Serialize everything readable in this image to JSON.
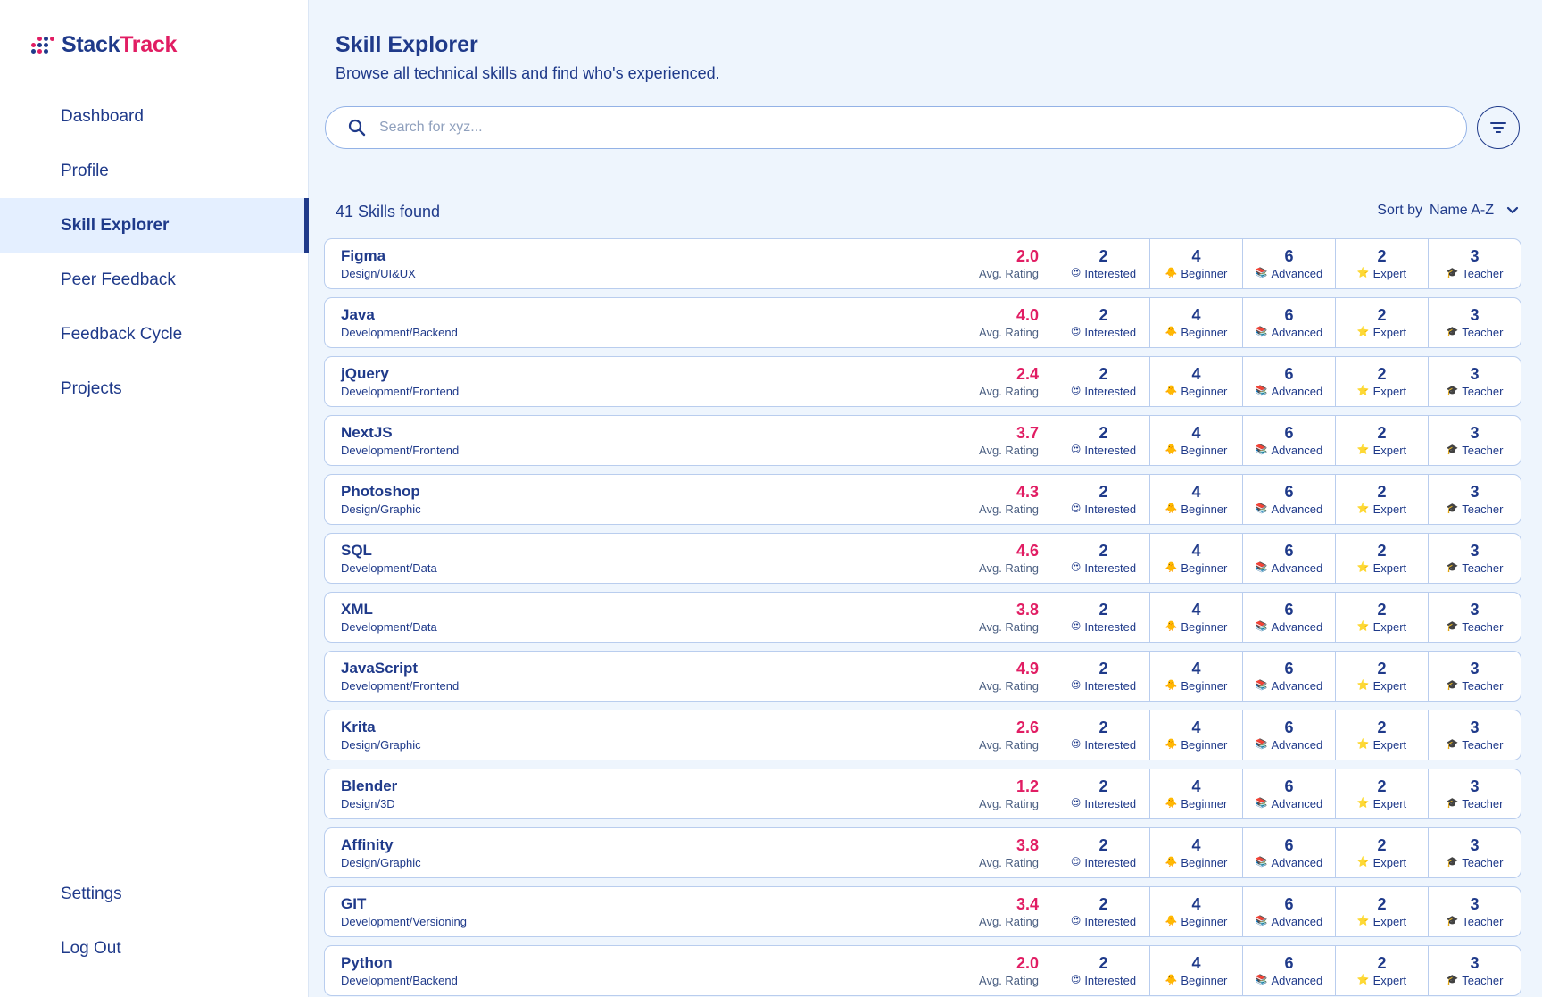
{
  "app": {
    "name_part1": "Stack",
    "name_part2": "Track"
  },
  "nav": {
    "items": [
      {
        "label": "Dashboard",
        "active": false
      },
      {
        "label": "Profile",
        "active": false
      },
      {
        "label": "Skill Explorer",
        "active": true
      },
      {
        "label": "Peer Feedback",
        "active": false
      },
      {
        "label": "Feedback Cycle",
        "active": false
      },
      {
        "label": "Projects",
        "active": false
      }
    ],
    "bottom": [
      {
        "label": "Settings"
      },
      {
        "label": "Log Out"
      }
    ]
  },
  "page": {
    "title": "Skill Explorer",
    "subtitle": "Browse all technical skills and find who's experienced."
  },
  "search": {
    "placeholder": "Search for xyz...",
    "value": ""
  },
  "results": {
    "count_text": "41 Skills found"
  },
  "sort": {
    "label": "Sort by",
    "value": "Name A-Z"
  },
  "labels": {
    "avg_rating": "Avg. Rating",
    "interested": "Interested",
    "beginner": "Beginner",
    "advanced": "Advanced",
    "expert": "Expert",
    "teacher": "Teacher"
  },
  "icons": {
    "interested": "😍",
    "beginner": "🐥",
    "advanced": "📚",
    "expert": "⭐",
    "teacher": "🎓"
  },
  "colors": {
    "primary": "#1f3a8a",
    "accent": "#e11d63",
    "background": "#eef5fd"
  },
  "skills": [
    {
      "name": "Figma",
      "category": "Design/UI&UX",
      "rating": "2.0",
      "interested": "2",
      "beginner": "4",
      "advanced": "6",
      "expert": "2",
      "teacher": "3"
    },
    {
      "name": "Java",
      "category": "Development/Backend",
      "rating": "4.0",
      "interested": "2",
      "beginner": "4",
      "advanced": "6",
      "expert": "2",
      "teacher": "3"
    },
    {
      "name": "jQuery",
      "category": "Development/Frontend",
      "rating": "2.4",
      "interested": "2",
      "beginner": "4",
      "advanced": "6",
      "expert": "2",
      "teacher": "3"
    },
    {
      "name": "NextJS",
      "category": "Development/Frontend",
      "rating": "3.7",
      "interested": "2",
      "beginner": "4",
      "advanced": "6",
      "expert": "2",
      "teacher": "3"
    },
    {
      "name": "Photoshop",
      "category": "Design/Graphic",
      "rating": "4.3",
      "interested": "2",
      "beginner": "4",
      "advanced": "6",
      "expert": "2",
      "teacher": "3"
    },
    {
      "name": "SQL",
      "category": "Development/Data",
      "rating": "4.6",
      "interested": "2",
      "beginner": "4",
      "advanced": "6",
      "expert": "2",
      "teacher": "3"
    },
    {
      "name": "XML",
      "category": "Development/Data",
      "rating": "3.8",
      "interested": "2",
      "beginner": "4",
      "advanced": "6",
      "expert": "2",
      "teacher": "3"
    },
    {
      "name": "JavaScript",
      "category": "Development/Frontend",
      "rating": "4.9",
      "interested": "2",
      "beginner": "4",
      "advanced": "6",
      "expert": "2",
      "teacher": "3"
    },
    {
      "name": "Krita",
      "category": "Design/Graphic",
      "rating": "2.6",
      "interested": "2",
      "beginner": "4",
      "advanced": "6",
      "expert": "2",
      "teacher": "3"
    },
    {
      "name": "Blender",
      "category": "Design/3D",
      "rating": "1.2",
      "interested": "2",
      "beginner": "4",
      "advanced": "6",
      "expert": "2",
      "teacher": "3"
    },
    {
      "name": "Affinity",
      "category": "Design/Graphic",
      "rating": "3.8",
      "interested": "2",
      "beginner": "4",
      "advanced": "6",
      "expert": "2",
      "teacher": "3"
    },
    {
      "name": "GIT",
      "category": "Development/Versioning",
      "rating": "3.4",
      "interested": "2",
      "beginner": "4",
      "advanced": "6",
      "expert": "2",
      "teacher": "3"
    },
    {
      "name": "Python",
      "category": "Development/Backend",
      "rating": "2.0",
      "interested": "2",
      "beginner": "4",
      "advanced": "6",
      "expert": "2",
      "teacher": "3"
    }
  ]
}
